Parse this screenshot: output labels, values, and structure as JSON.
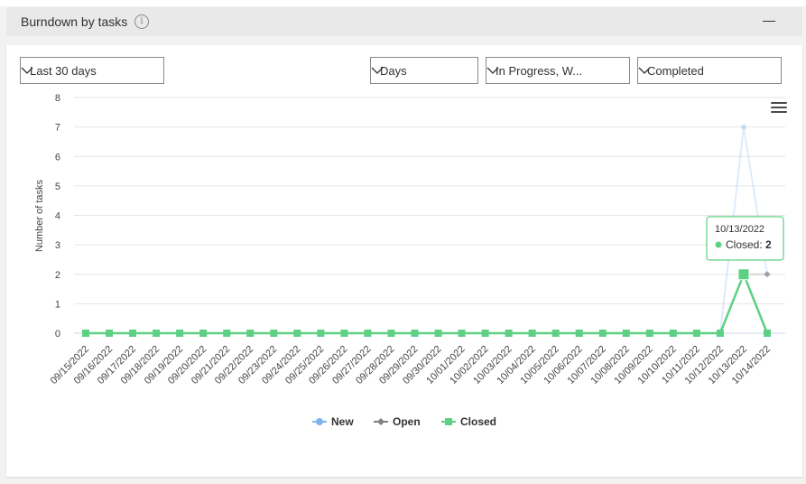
{
  "header": {
    "title": "Burndown by tasks",
    "info_icon": "i"
  },
  "filters": {
    "range": "Last 30 days",
    "granularity": "Days",
    "states": "In Progress, W...",
    "completed": "Completed"
  },
  "tooltip": {
    "date": "10/13/2022",
    "label": "Closed: ",
    "value": "2"
  },
  "chart_data": {
    "type": "line",
    "ylabel": "Number of tasks",
    "ylim": [
      0,
      8
    ],
    "yticks": [
      0,
      1,
      2,
      3,
      4,
      5,
      6,
      7,
      8
    ],
    "categories": [
      "09/15/2022",
      "09/16/2022",
      "09/17/2022",
      "09/18/2022",
      "09/19/2022",
      "09/20/2022",
      "09/21/2022",
      "09/22/2022",
      "09/23/2022",
      "09/24/2022",
      "09/25/2022",
      "09/26/2022",
      "09/27/2022",
      "09/28/2022",
      "09/29/2022",
      "09/30/2022",
      "10/01/2022",
      "10/02/2022",
      "10/03/2022",
      "10/04/2022",
      "10/05/2022",
      "10/06/2022",
      "10/07/2022",
      "10/08/2022",
      "10/09/2022",
      "10/10/2022",
      "10/11/2022",
      "10/12/2022",
      "10/13/2022",
      "10/14/2022"
    ],
    "series": [
      {
        "name": "New",
        "color": "#7cb5ec",
        "values": [
          null,
          null,
          null,
          null,
          null,
          null,
          null,
          null,
          null,
          null,
          null,
          null,
          null,
          null,
          null,
          null,
          null,
          null,
          null,
          null,
          null,
          null,
          null,
          null,
          null,
          null,
          null,
          0,
          7,
          2
        ]
      },
      {
        "name": "Open",
        "color": "#808080",
        "values": [
          null,
          null,
          null,
          null,
          null,
          null,
          null,
          null,
          null,
          null,
          null,
          null,
          null,
          null,
          null,
          null,
          null,
          null,
          null,
          null,
          null,
          null,
          null,
          null,
          null,
          null,
          null,
          null,
          2,
          2
        ]
      },
      {
        "name": "Closed",
        "color": "#5ed084",
        "values": [
          0,
          0,
          0,
          0,
          0,
          0,
          0,
          0,
          0,
          0,
          0,
          0,
          0,
          0,
          0,
          0,
          0,
          0,
          0,
          0,
          0,
          0,
          0,
          0,
          0,
          0,
          0,
          0,
          2,
          0
        ]
      }
    ],
    "legend": "bottom-center",
    "grid": true
  }
}
